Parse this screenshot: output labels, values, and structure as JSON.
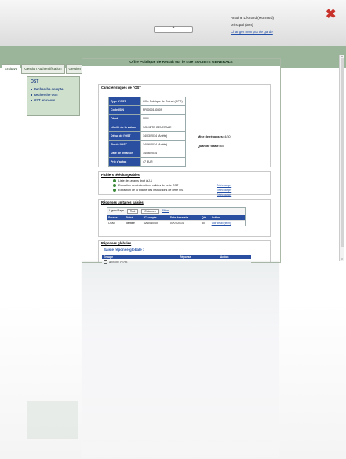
{
  "header": {
    "user_name": "Antoine Léonard (Monnard)",
    "user_line2": "principal (bon)",
    "change_profile_link": "Changer mon pot de garde",
    "toggle_label": "⌃",
    "close_label": "✖"
  },
  "nav": {
    "tabs": [
      "Entitavo",
      "Gestion Authentification",
      "Gestion des Ordres"
    ]
  },
  "sidebar": {
    "title": "OST",
    "items": [
      "Recherche compte",
      "Recherche OST",
      "OST en cours"
    ]
  },
  "content": {
    "title": "Offre Publique de Retrait sur le titre SOCIETE GENERALE",
    "characteristics": {
      "title": "Caractéristiques de l'OST",
      "rows": [
        {
          "k": "Type d'OST",
          "v": "Offre Publique de Retrait (OPR)"
        },
        {
          "k": "Code ISIN",
          "v": "FR0000130809"
        },
        {
          "k": "Objet",
          "v": "0001"
        },
        {
          "k": "Libellé de la valeur",
          "v": "SOCIETE GENERALE"
        },
        {
          "k": "Début de l'OST",
          "v": "14/03/2014 (Arrêté)"
        },
        {
          "k": "Fin de l'OST",
          "v": "14/06/2014 (Arrêté)"
        },
        {
          "k": "Date de livraison",
          "v": "14/06/2014"
        },
        {
          "k": "Prix d'achat",
          "v": "47 EUR"
        }
      ],
      "stat1_label": "Mise de réponses:",
      "stat1_value": "4/30",
      "stat2_label": "Quantité totale:",
      "stat2_value": "60"
    },
    "files": {
      "title": "Fichiers téléchargeables",
      "rows": [
        {
          "label": "Liste des ayants droit à J-1",
          "link": "[ Télécharger ]"
        },
        {
          "label": "Extraction des instructions valides de cette OST",
          "link": "[ Télécharger ]"
        },
        {
          "label": "Extraction de la totalité des instructions de cette OST",
          "link": "[ Télécharger ]"
        }
      ]
    },
    "unit_responses": {
      "title": "Réponses unitaires saisies",
      "filter": {
        "lines_label": "Lignes/Page",
        "lines_value": "Tout",
        "columns_value": "Colonnes",
        "filter_link": "Filtres"
      },
      "columns": [
        "Source",
        "Statut",
        "N° compte",
        "Date de saisie",
        "Qté",
        "Action"
      ],
      "rows": [
        [
          "OSM",
          "Identifié",
          "5262040404",
          "03/07/2014",
          "50",
          "Voir détail (tech)"
        ]
      ]
    },
    "global_responses": {
      "title": "Réponses globales",
      "subtitle": "Saisie réponse globale :",
      "columns": [
        "Groupe",
        "Réponse",
        "Action"
      ],
      "rows": [
        [
          "ASS VIE CLOS",
          "",
          ""
        ]
      ]
    }
  },
  "colors": {
    "band": "#9bb59a",
    "table_head": "#2b4fa0",
    "close": "#c8322b",
    "link": "#2250a8"
  }
}
